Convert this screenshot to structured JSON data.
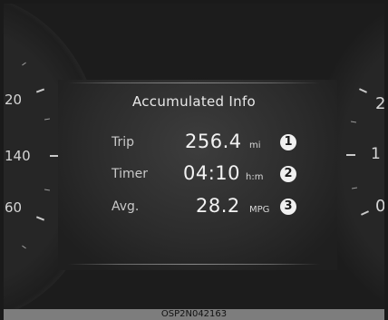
{
  "panel": {
    "title": "Accumulated Info",
    "rows": [
      {
        "label": "Trip",
        "value": "256.4",
        "unit": "mi",
        "badge": "1"
      },
      {
        "label": "Timer",
        "value": "04:10",
        "unit": "h:m",
        "badge": "2"
      },
      {
        "label": "Avg.",
        "value": "28.2",
        "unit": "MPG",
        "badge": "3"
      }
    ]
  },
  "gauges": {
    "left_ticks": [
      "20",
      "140",
      "60"
    ],
    "right_ticks": [
      "2",
      "1",
      "0"
    ]
  },
  "caption": "OSP2N042163"
}
